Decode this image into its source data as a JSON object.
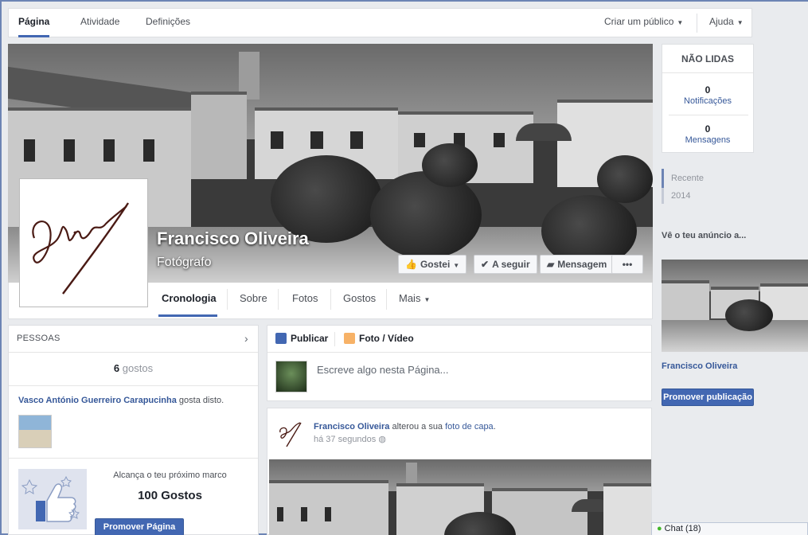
{
  "topnav": {
    "tabs": [
      "Página",
      "Atividade",
      "Definições"
    ],
    "create_audience": "Criar um público",
    "help": "Ajuda"
  },
  "cover": {
    "page_name": "Francisco Oliveira",
    "category": "Fotógrafo",
    "buttons": {
      "liked": "Gostei",
      "following": "A seguir",
      "message": "Mensagem",
      "more": "•••"
    }
  },
  "page_tabs": [
    "Cronologia",
    "Sobre",
    "Fotos",
    "Gostos",
    "Mais"
  ],
  "people": {
    "header": "PESSOAS",
    "likes_count": "6",
    "likes_word": "gostos",
    "friend_name": "Vasco António Guerreiro Carapucinha",
    "friend_suffix": "gosta disto.",
    "milestone_text": "Alcança o teu próximo marco",
    "milestone_goal": "100 Gostos",
    "promote_page": "Promover Página"
  },
  "composer": {
    "publish_tab": "Publicar",
    "photo_tab": "Foto / Vídeo",
    "placeholder": "Escreve algo nesta Página..."
  },
  "post": {
    "author": "Francisco Oliveira",
    "action": "alterou a sua",
    "object": "foto de capa",
    "time": "há 37 segundos"
  },
  "right": {
    "unread_header": "NÃO LIDAS",
    "notifications_count": "0",
    "notifications_label": "Notificações",
    "messages_count": "0",
    "messages_label": "Mensagens",
    "recent": "Recente",
    "year": "2014",
    "ad_title": "Vê o teu anúncio a...",
    "ad_name": "Francisco Oliveira",
    "promote_post": "Promover publicação"
  },
  "chat": {
    "label": "Chat (18)"
  },
  "colors": {
    "accent": "#4267b2",
    "link": "#365899",
    "background": "#e9ebee"
  }
}
